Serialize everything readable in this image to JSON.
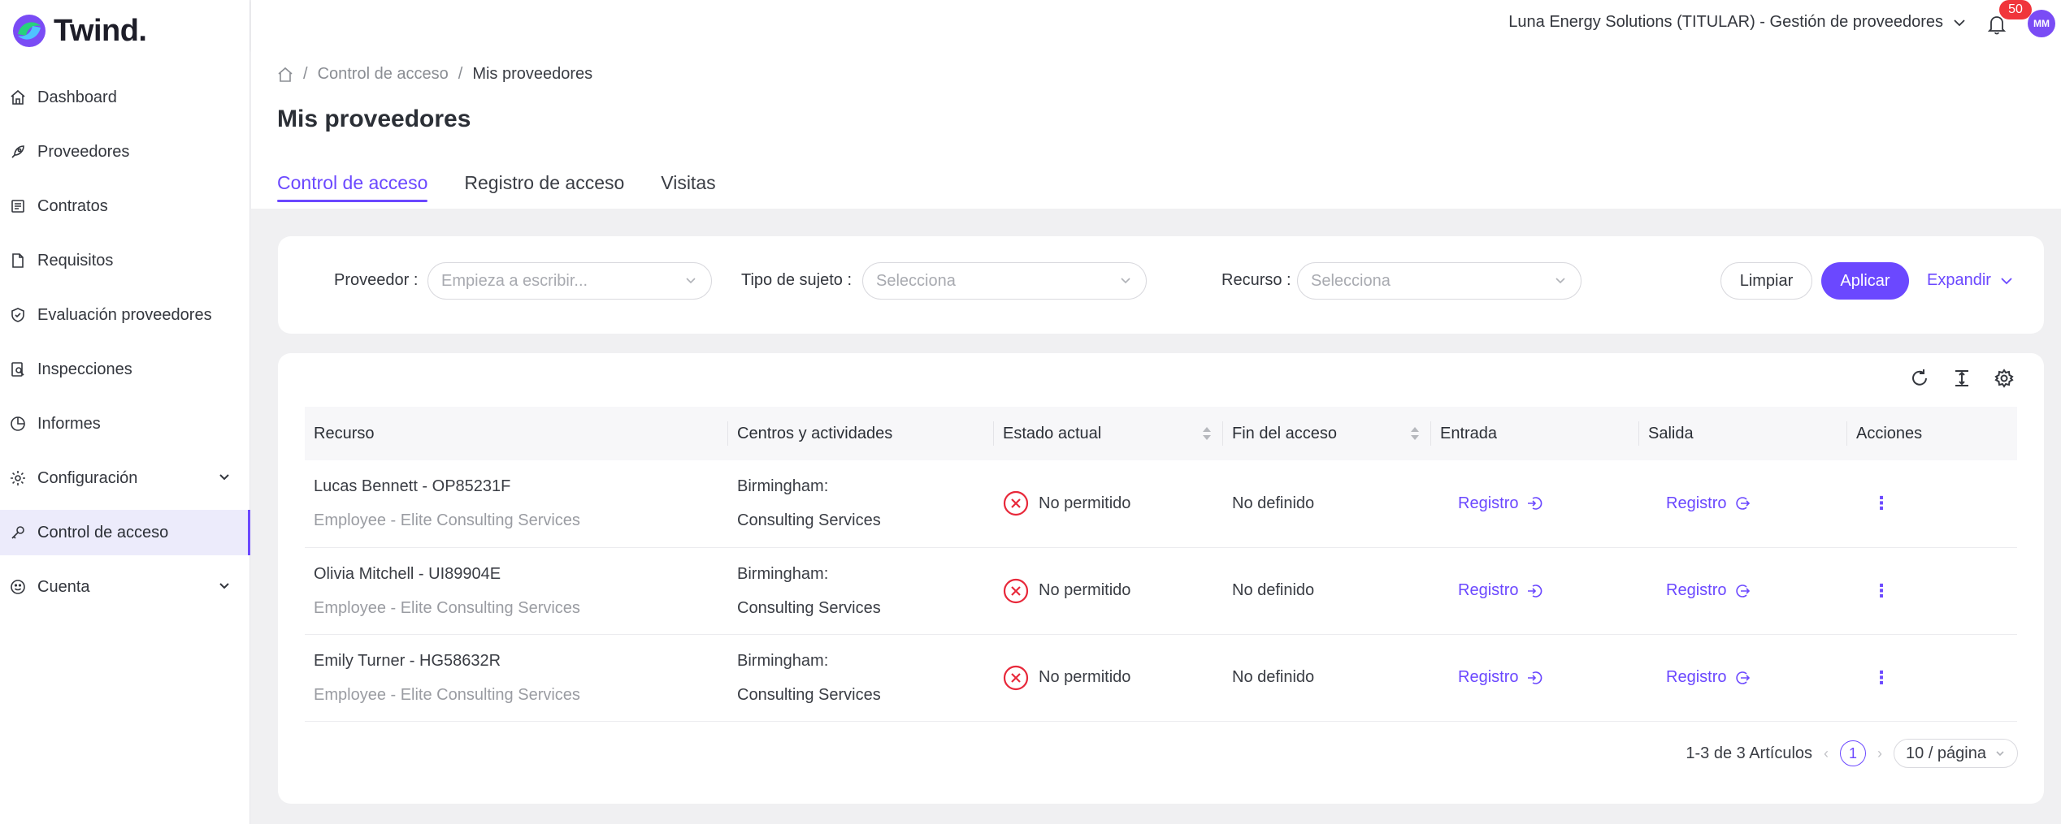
{
  "app": {
    "name": "Twind."
  },
  "topbar": {
    "organization": "Luna Energy Solutions (TITULAR) - Gestión de proveedores",
    "notifications_count": "50",
    "avatar_initials": "MM"
  },
  "sidebar": {
    "items": [
      {
        "label": "Dashboard",
        "icon": "home-icon"
      },
      {
        "label": "Proveedores",
        "icon": "rocket-icon"
      },
      {
        "label": "Contratos",
        "icon": "contract-icon"
      },
      {
        "label": "Requisitos",
        "icon": "file-icon"
      },
      {
        "label": "Evaluación proveedores",
        "icon": "shield-check-icon"
      },
      {
        "label": "Inspecciones",
        "icon": "inspection-icon"
      },
      {
        "label": "Informes",
        "icon": "pie-chart-icon"
      },
      {
        "label": "Configuración",
        "icon": "gear-icon",
        "expandable": true
      },
      {
        "label": "Control de acceso",
        "icon": "key-icon",
        "active": true
      },
      {
        "label": "Cuenta",
        "icon": "smile-icon",
        "expandable": true
      }
    ]
  },
  "breadcrumb": {
    "section": "Control de acceso",
    "current": "Mis proveedores"
  },
  "page": {
    "title": "Mis proveedores"
  },
  "tabs": [
    {
      "label": "Control de acceso",
      "active": true
    },
    {
      "label": "Registro de acceso"
    },
    {
      "label": "Visitas"
    }
  ],
  "filters": {
    "provider_label": "Proveedor",
    "provider_placeholder": "Empieza a escribir...",
    "subject_label": "Tipo de sujeto",
    "subject_placeholder": "Selecciona",
    "resource_label": "Recurso",
    "resource_placeholder": "Selecciona",
    "clear": "Limpiar",
    "apply": "Aplicar",
    "expand": "Expandir"
  },
  "table": {
    "headers": [
      "Recurso",
      "Centros y actividades",
      "Estado actual",
      "Fin del acceso",
      "Entrada",
      "Salida",
      "Acciones"
    ],
    "rows": [
      {
        "name": "Lucas Bennett - OP85231F",
        "role": "Employee - Elite Consulting Services",
        "center": "Birmingham:",
        "activity": "Consulting Services",
        "status": "No permitido",
        "end": "No definido",
        "entry": "Registro",
        "exit": "Registro"
      },
      {
        "name": "Olivia Mitchell - UI89904E",
        "role": "Employee - Elite Consulting Services",
        "center": "Birmingham:",
        "activity": "Consulting Services",
        "status": "No permitido",
        "end": "No definido",
        "entry": "Registro",
        "exit": "Registro"
      },
      {
        "name": "Emily Turner - HG58632R",
        "role": "Employee - Elite Consulting Services",
        "center": "Birmingham:",
        "activity": "Consulting Services",
        "status": "No permitido",
        "end": "No definido",
        "entry": "Registro",
        "exit": "Registro"
      }
    ]
  },
  "pagination": {
    "summary": "1-3 de 3 Artículos",
    "current_page": "1",
    "page_size": "10 / página"
  },
  "colors": {
    "accent": "#6b48ff",
    "error": "#e8283a",
    "badge": "#f0353b"
  }
}
